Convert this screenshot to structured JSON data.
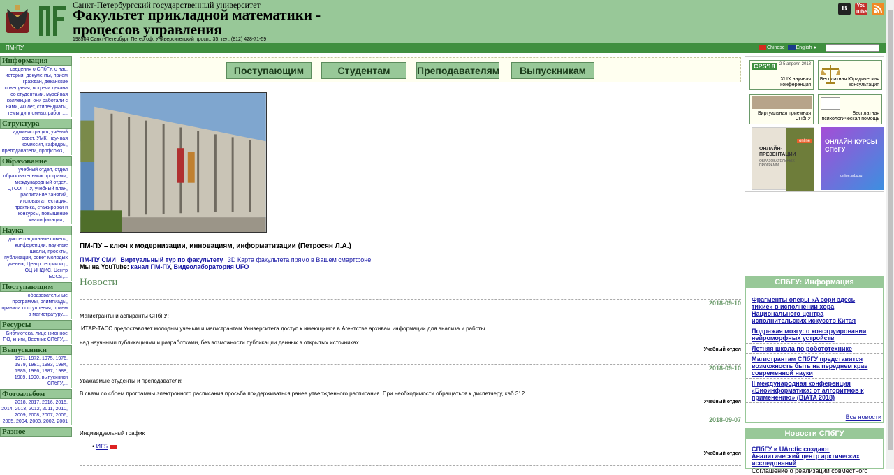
{
  "header": {
    "university": "Санкт-Петербургский государственный университет",
    "faculty_line1": "Факультет прикладной математики -",
    "faculty_line2": "процессов управления",
    "address": "198504 Санкт-Петербург, Петергоф, Университетский просп., 35, тел. (812) 428-71-59",
    "social": [
      "vk-icon",
      "youtube-icon",
      "rss-icon"
    ]
  },
  "topbar": {
    "label": "ПМ-ПУ",
    "lang_cn": "Chinese",
    "lang_en": "English",
    "search_value": ""
  },
  "sidebar": [
    {
      "title": "Информация",
      "body": "сведения о СПбГУ, о нас, история, документы, прием граждан, деканские совещания, встречи декана со студентами, музейная коллекция, они работали с нами, 40 лет, стипендиаты, темы дипломных работ ,..."
    },
    {
      "title": "Структура",
      "body": "администрация, учёный совет, УМК, научная комиссия, кафедры, преподаватели, профсоюз,..."
    },
    {
      "title": "Образование",
      "body": "учебный отдел, отдел образовательных программ, международный отдел, ЦТСОП ПУ, учебный план, расписание занятий, итоговая аттестация, практика, стажировки и конкурсы, повышение квалификации,..."
    },
    {
      "title": "Наука",
      "body": "диссертационные советы, конференции, научные школы, проекты, публикации, совет молодых ученых, Центр теории игр, НОЦ ИНДИС, Центр ECCS,..."
    },
    {
      "title": "Поступающим",
      "body": "образовательные программы, олимпиады, правила поступления, прием в магистратуру,..."
    },
    {
      "title": "Ресурсы",
      "body": "Библиотека, лицензионное ПО, книги, Вестник СПбГУ,..."
    },
    {
      "title": "Выпускники",
      "body": "1971, 1972, 1975, 1976, 1979, 1981, 1983, 1984, 1985, 1986, 1987, 1988, 1989, 1990, выпускники СПбГУ,..."
    },
    {
      "title": "Фотоальбом",
      "body": "2018, 2017, 2016, 2015, 2014, 2013, 2012, 2011, 2010, 2009, 2008, 2007, 2006, 2005, 2004, 2003, 2002, 2001"
    },
    {
      "title": "Разное",
      "body": ""
    }
  ],
  "menu": [
    "Поступающим",
    "Студентам",
    "Преподавателям",
    "Выпускникам"
  ],
  "slogan": "ПМ-ПУ – ключ к модернизации, инновациям, информатизации (Петросян Л.А.)",
  "links": {
    "smi": "ПМ-ПУ СМИ",
    "tour": "Виртуальный тур по факультету",
    "map3d": "3D Карта факультета прямо в Вашем смартфоне!",
    "youtube_prefix": "Мы на YouTube:",
    "youtube_channel": "канал ПМ-ПУ",
    "video_lab": "Видеолаборатория UFO"
  },
  "news_heading": "Новости",
  "news": [
    {
      "date": "2018-09-10",
      "lines": [
        "Магистранты и аспиранты СПбГУ!",
        "ИТАР-ТАСС предоставляет молодым ученым и магистрантам Университета доступ к имеющимся в Агентстве архивам информации для анализа и работы",
        "над научными публикациями и разработками, без возможности публикации данных в открытых источниках."
      ],
      "signature": "Учебный отдел"
    },
    {
      "date": "2018-09-10",
      "lines": [
        "Уважаемые студенты и преподаватели!",
        "В  связи со сбоем программы электронного расписания просьба придерживаться ранее утвержденного расписания. При необходимости обращаться к диспетчеру, каб.312"
      ],
      "signature": "Учебный отдел"
    },
    {
      "date": "2018-09-07",
      "lines": [
        "Индивидуальный график"
      ],
      "item": "ИГ5",
      "signature": "Учебный отдел"
    }
  ],
  "promos": [
    {
      "title": "XLIX научная конференция",
      "date": "2-5 апреля 2018",
      "badge": "CPS'18"
    },
    {
      "title": "Бесплатная Юридическая консультация"
    },
    {
      "title": "Виртуальная приемная СПбГУ"
    },
    {
      "title": "Бесплатная психологическая помощь"
    }
  ],
  "banners": {
    "online_pres_badge": "online",
    "online_pres_title": "ОНЛАЙН-ПРЕЗЕНТАЦИИ",
    "online_pres_sub": "ОБРАЗОВАТЕЛЬНЫХ ПРОГРАММ",
    "courses_title": "ОНЛАЙН-КУРСЫ СПбГУ",
    "courses_url": "online.spbu.ru"
  },
  "spbu_info": {
    "title": "СПбГУ: Информация",
    "items": [
      "Фрагменты оперы «А зори здесь тихие» в исполнении хора Национального центра исполнительских искусств Китая",
      "Подражая мозгу: о конструировании нейроморфных устройств",
      "Летняя школа по робототехнике",
      "Магистрантам СПбГУ представится возможность быть на переднем крае современной науки",
      "II международная конференция «Биоинформатика: от алгоритмов к применению» (BiATA 2018)"
    ],
    "all": "Все новости"
  },
  "spbu_news": {
    "title": "Новости СПбГУ",
    "item_title": "СПбГУ и UArctic создают Аналитический центр арктических исследований",
    "item_text": "Соглашение о реализации совместного"
  },
  "colors": {
    "green": "#98c898",
    "dark_green": "#3f8f3f",
    "link": "#1a1aa6"
  }
}
